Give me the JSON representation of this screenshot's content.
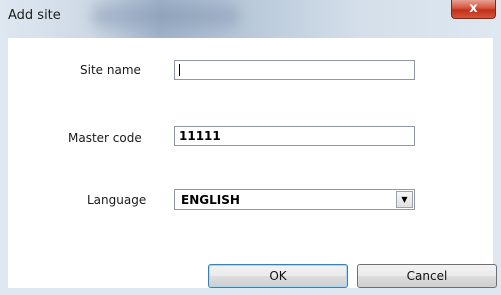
{
  "window": {
    "title": "Add site",
    "close_glyph": "x"
  },
  "form": {
    "site_name": {
      "label": "Site name",
      "value": ""
    },
    "master_code": {
      "label": "Master code",
      "value": "11111"
    },
    "language": {
      "label": "Language",
      "value": "ENGLISH",
      "arrow_icon": "chevron-down-icon"
    }
  },
  "buttons": {
    "ok_label": "OK",
    "cancel_label": "Cancel"
  }
}
